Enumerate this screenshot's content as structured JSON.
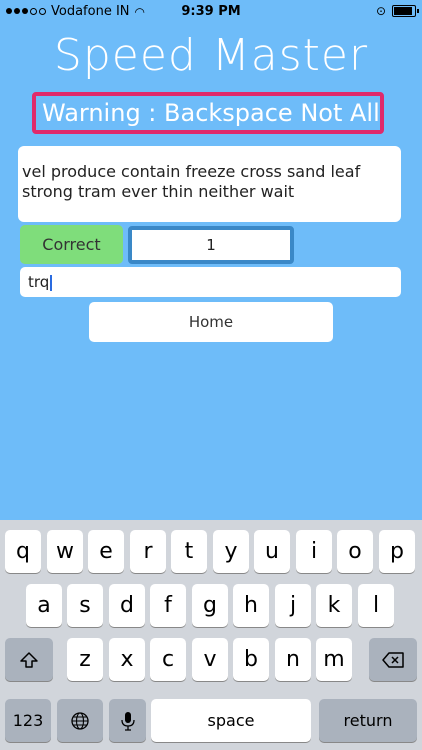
{
  "status_bar": {
    "carrier": "Vodafone IN",
    "time": "9:39 PM"
  },
  "app": {
    "title": "Speed Master",
    "warning": "Warning : Backspace Not All...",
    "passage": "vel produce contain freeze cross sand leaf strong tram ever thin neither wait",
    "correct_label": "Correct",
    "correct_count": "1",
    "typed_text": "trq",
    "home_label": "Home"
  },
  "keyboard": {
    "row1": [
      "q",
      "w",
      "e",
      "r",
      "t",
      "y",
      "u",
      "i",
      "o",
      "p"
    ],
    "row2": [
      "a",
      "s",
      "d",
      "f",
      "g",
      "h",
      "j",
      "k",
      "l"
    ],
    "row3": [
      "z",
      "x",
      "c",
      "v",
      "b",
      "n",
      "m"
    ],
    "numbers_label": "123",
    "space_label": "space",
    "return_label": "return"
  },
  "colors": {
    "background": "#6ebcf9",
    "warning_border": "#e02a6c",
    "correct_button": "#7fdd7b",
    "score_border": "#3a88c7"
  }
}
